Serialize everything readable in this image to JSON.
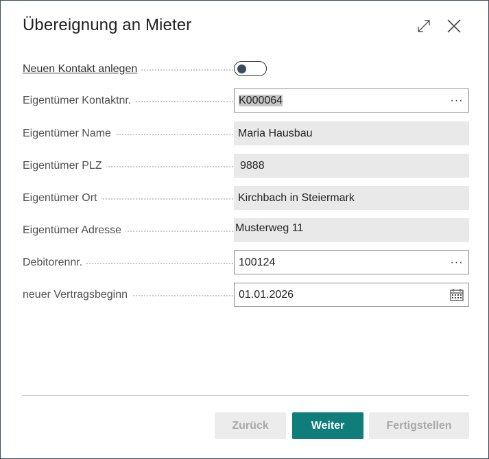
{
  "dialog": {
    "title": "Übereignung an Mieter",
    "expand_icon": "expand-icon",
    "close_icon": "close-icon"
  },
  "fields": {
    "new_contact": {
      "label": "Neuen Kontakt anlegen",
      "toggle_state": "off"
    },
    "owner_contact_no": {
      "label": "Eigentümer Kontaktnr.",
      "value": "K000064",
      "suffix": "···"
    },
    "owner_name": {
      "label": "Eigentümer Name",
      "value": "Maria Hausbau"
    },
    "owner_zip": {
      "label": "Eigentümer PLZ",
      "value": "9888"
    },
    "owner_city": {
      "label": "Eigentümer Ort",
      "value": "Kirchbach in Steiermark"
    },
    "owner_address": {
      "label": "Eigentümer Adresse",
      "value": "Musterweg 11"
    },
    "customer_no": {
      "label": "Debitorennr.",
      "value": "100124",
      "suffix": "···"
    },
    "contract_start": {
      "label": "neuer Vertragsbeginn",
      "value": "01.01.2026",
      "icon": "calendar-icon"
    }
  },
  "buttons": {
    "back": "Zurück",
    "next": "Weiter",
    "finish": "Fertigstellen"
  },
  "colors": {
    "primary": "#0f7d7a",
    "readonly_bg": "#e9e9e9",
    "disabled_bg": "#ececec"
  }
}
